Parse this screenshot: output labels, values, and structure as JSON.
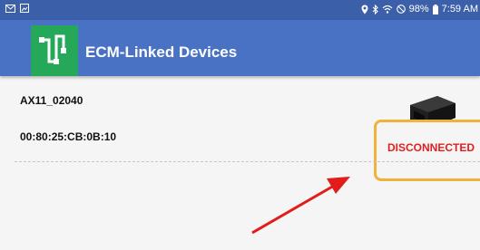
{
  "status_bar": {
    "battery": "98%",
    "time": "7:59 AM",
    "icons": [
      "mail-icon",
      "image-icon",
      "location-icon",
      "bluetooth-icon",
      "wifi-icon",
      "do-not-disturb-icon",
      "battery-icon"
    ]
  },
  "app_bar": {
    "title": "ECM-Linked Devices",
    "logo": "app-logo-icon"
  },
  "devices": [
    {
      "name": "AX11_02040",
      "mac": "00:80:25:CB:0B:10",
      "status": "DISCONNECTED",
      "icon": "obd-adapter-icon"
    }
  ],
  "colors": {
    "status_bar": "#3b5fa8",
    "app_bar": "#4a72c4",
    "logo": "#25a85a",
    "disconnected": "#e02020",
    "highlight": "#f0b23a",
    "arrow": "#e21b1b"
  }
}
